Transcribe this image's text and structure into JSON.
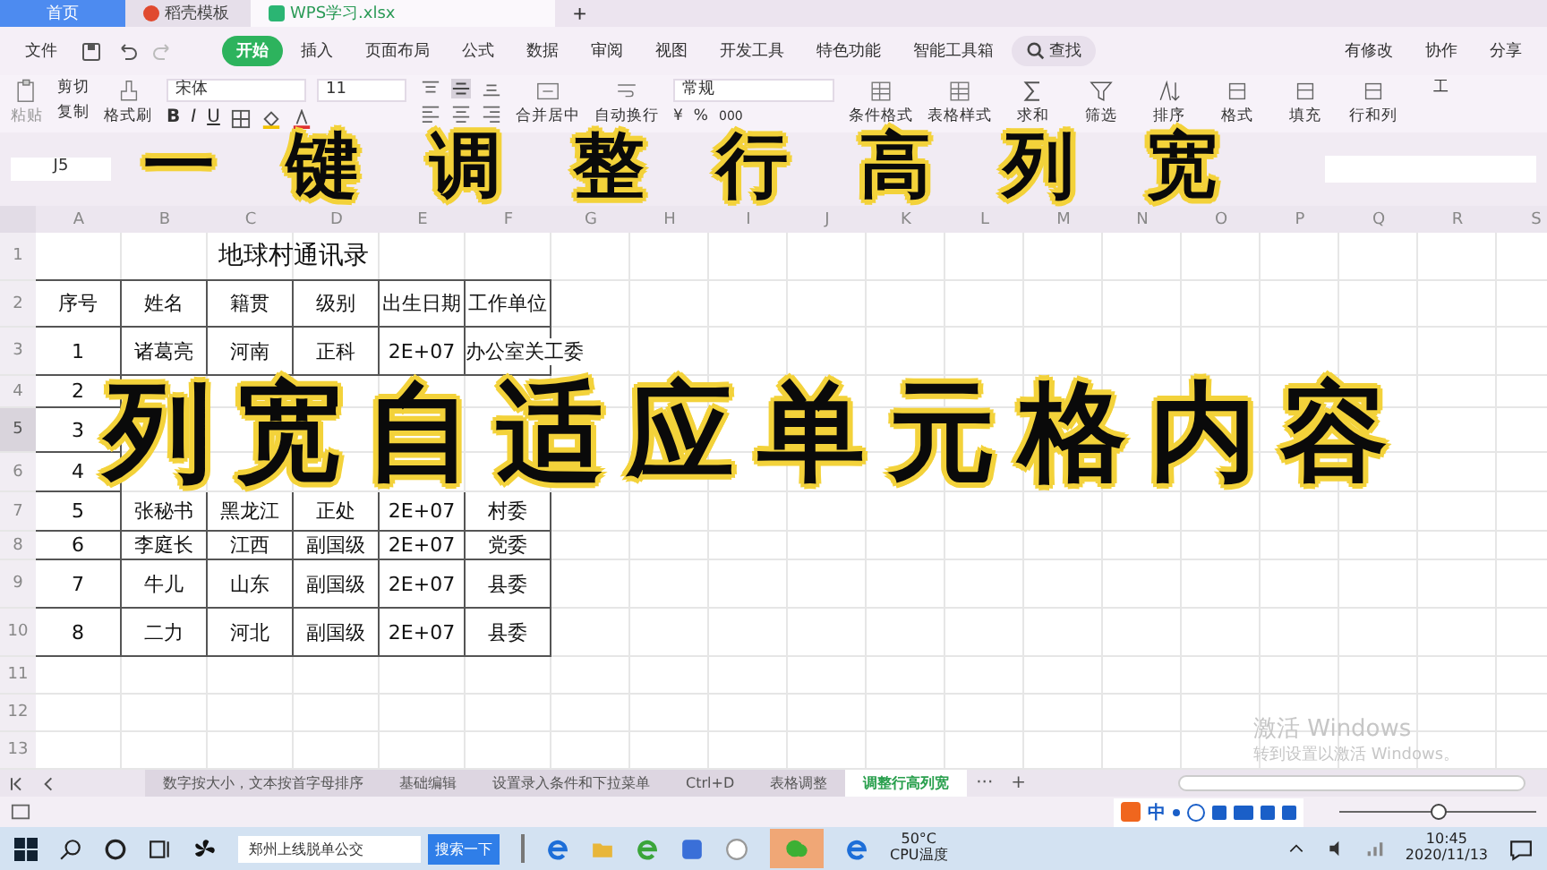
{
  "browser_tabs": [
    {
      "label": "首页",
      "selected": false
    },
    {
      "label": "稻壳模板",
      "selected": false
    },
    {
      "label": "WPS学习.xlsx",
      "selected": true
    }
  ],
  "new_tab": "+",
  "menu": {
    "file": "文件",
    "tabs": [
      {
        "label": "开始",
        "selected": true
      },
      {
        "label": "插入",
        "selected": false
      },
      {
        "label": "页面布局",
        "selected": false
      },
      {
        "label": "公式",
        "selected": false
      },
      {
        "label": "数据",
        "selected": false
      },
      {
        "label": "审阅",
        "selected": false
      },
      {
        "label": "视图",
        "selected": false
      },
      {
        "label": "开发工具",
        "selected": false
      },
      {
        "label": "特色功能",
        "selected": false
      },
      {
        "label": "智能工具箱",
        "selected": false
      }
    ],
    "search": "查找",
    "actions": [
      "有修改",
      "协作",
      "分享"
    ]
  },
  "ribbon": {
    "paste": "粘贴",
    "cut": "剪切",
    "copy": "复制",
    "format_painter": "格式刷",
    "font_name": "宋体",
    "font_size": "11",
    "text_styles": [
      "B",
      "I",
      "U"
    ],
    "merge": "合并居中",
    "wrap": "自动换行",
    "number_format": "常规",
    "currency": "¥",
    "percent": "%",
    "thousands": "000",
    "large_buttons": [
      "条件格式",
      "表格样式",
      "求和",
      "筛选",
      "排序",
      "格式",
      "填充",
      "行和列",
      "工"
    ]
  },
  "formula_bar": {
    "cell_ref": "J5"
  },
  "sheet": {
    "columns": [
      "A",
      "B",
      "C",
      "D",
      "E",
      "F",
      "G",
      "H",
      "I",
      "J",
      "K",
      "L",
      "M",
      "N",
      "O",
      "P",
      "Q",
      "R",
      "S"
    ],
    "title": "地球村通讯录",
    "rows": [
      {
        "number": "1",
        "kind": "title",
        "selected": false,
        "cells": []
      },
      {
        "number": "2",
        "kind": "data",
        "selected": false,
        "cells": [
          "序号",
          "姓名",
          "籍贯",
          "级别",
          "出生日期",
          "工作单位"
        ]
      },
      {
        "number": "3",
        "kind": "data",
        "selected": false,
        "cells": [
          "1",
          "诸葛亮",
          "河南",
          "正科",
          "2E+07",
          "办公室关工委"
        ]
      },
      {
        "number": "4",
        "kind": "data",
        "selected": false,
        "cells": [
          "2"
        ]
      },
      {
        "number": "5",
        "kind": "data",
        "selected": true,
        "cells": [
          "3"
        ]
      },
      {
        "number": "6",
        "kind": "data",
        "selected": false,
        "cells": [
          "4"
        ]
      },
      {
        "number": "7",
        "kind": "data",
        "selected": false,
        "cells": [
          "5",
          "张秘书",
          "黑龙江",
          "正处",
          "2E+07",
          "村委"
        ]
      },
      {
        "number": "8",
        "kind": "data",
        "selected": false,
        "cells": [
          "6",
          "李庭长",
          "江西",
          "副国级",
          "2E+07",
          "党委"
        ]
      },
      {
        "number": "9",
        "kind": "data",
        "selected": false,
        "cells": [
          "7",
          "牛儿",
          "山东",
          "副国级",
          "2E+07",
          "县委"
        ]
      },
      {
        "number": "10",
        "kind": "data",
        "selected": false,
        "cells": [
          "8",
          "二力",
          "河北",
          "副国级",
          "2E+07",
          "县委"
        ]
      },
      {
        "number": "11",
        "kind": "empty",
        "selected": false,
        "cells": []
      },
      {
        "number": "12",
        "kind": "empty",
        "selected": false,
        "cells": []
      },
      {
        "number": "13",
        "kind": "empty",
        "selected": false,
        "cells": []
      }
    ]
  },
  "caption": [
    "一键调整行高列宽",
    "列宽自适应单元格内容"
  ],
  "sheet_tabs": [
    {
      "label": "数字按大小，文本按首字母排序",
      "selected": false
    },
    {
      "label": "基础编辑",
      "selected": false
    },
    {
      "label": "设置录入条件和下拉菜单",
      "selected": false
    },
    {
      "label": "Ctrl+D",
      "selected": false
    },
    {
      "label": "表格调整",
      "selected": false
    },
    {
      "label": "调整行高列宽",
      "selected": true
    }
  ],
  "more_tabs": "···",
  "add_sheet": "+",
  "activation": [
    "激活 Windows",
    "转到设置以激活 Windows。"
  ],
  "ime": {
    "mode": "中"
  },
  "zoom_slider": {
    "level": 0.5
  },
  "taskbar": {
    "search_text": "郑州上线脱单公交",
    "search_button": "搜索一下",
    "temperature": "50°C",
    "temperature_label": "CPU温度",
    "time": "10:45",
    "date": "2020/11/13"
  }
}
